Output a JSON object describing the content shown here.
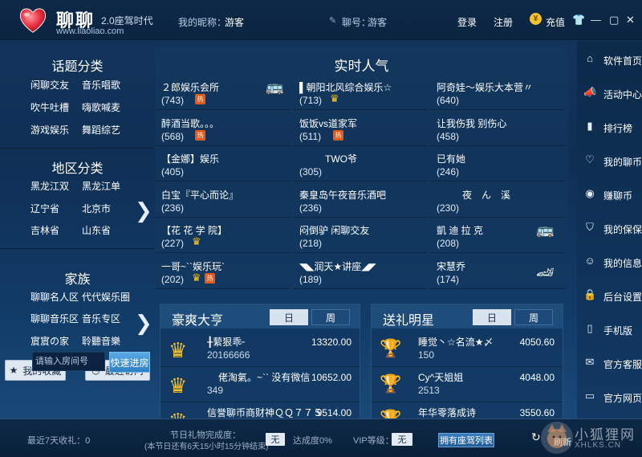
{
  "header": {
    "app_name": "聊聊",
    "version": "2.0座驾时代",
    "url": "www.liaoliao.com",
    "nickname_label": "我的昵称：",
    "nickname_value": "游客",
    "account_label": "聊号：",
    "account_value": "游客",
    "login": "登录",
    "register": "注册",
    "recharge": "充值"
  },
  "left": {
    "topic_title": "话题分类",
    "topics": [
      "闲聊交友",
      "音乐唱歌",
      "吹牛吐槽",
      "嗨歌喊麦",
      "游戏娱乐",
      "舞蹈综艺"
    ],
    "region_title": "地区分类",
    "regions": [
      "黑龙江双",
      "黑龙江单",
      "辽宁省",
      "北京市",
      "吉林省",
      "山东省"
    ],
    "family_title": "家族",
    "families": [
      "聊聊名人区",
      "代代娱乐圈",
      "聊聊音乐区",
      "音乐专区",
      "賔賔の家",
      "聆聽音樂"
    ],
    "favorites": "我的收藏",
    "recent": "最近访问",
    "room_label": "房间号",
    "room_placeholder": "请输入房间号",
    "enter_room": "快速进房"
  },
  "popular": {
    "title": "实时人气",
    "rooms": [
      {
        "name": "２郎娱乐会所",
        "count": "(743)",
        "badge": "hot",
        "car": "bus"
      },
      {
        "name": "▌朝阳北风综合娱乐☆",
        "count": "(713)",
        "badge": "crown",
        "car": ""
      },
      {
        "name": "阿奇娃～娱乐大本营〃",
        "count": "(640)",
        "badge": "",
        "car": ""
      },
      {
        "name": "醉酒当歌。。。",
        "count": "(568)",
        "badge": "hot",
        "car": ""
      },
      {
        "name": "饭饭vs道家军",
        "count": "(511)",
        "badge": "hot",
        "car": ""
      },
      {
        "name": "让我伤我 别伤心",
        "count": "(458)",
        "badge": "",
        "car": ""
      },
      {
        "name": "【金娜】娱乐",
        "count": "(405)",
        "badge": "",
        "car": ""
      },
      {
        "name": "TWO爷",
        "count": "(305)",
        "badge": "",
        "car": ""
      },
      {
        "name": "已有她",
        "count": "(246)",
        "badge": "",
        "car": ""
      },
      {
        "name": "白宝『平心而论』",
        "count": "(236)",
        "badge": "",
        "car": ""
      },
      {
        "name": "秦皇岛午夜音乐酒吧",
        "count": "(236)",
        "badge": "",
        "car": ""
      },
      {
        "name": "夜　ん　溪",
        "count": "(230)",
        "badge": "",
        "car": ""
      },
      {
        "name": "【花 花 学 院】",
        "count": "(227)",
        "badge": "crown",
        "car": ""
      },
      {
        "name": "闷倒驴 闲聊交友",
        "count": "(218)",
        "badge": "",
        "car": ""
      },
      {
        "name": "凱 迪 拉 克",
        "count": "(208)",
        "badge": "",
        "car": "bus"
      },
      {
        "name": "一哥~``娱乐玩`",
        "count": "(202)",
        "badge": "crown-hot",
        "car": ""
      },
      {
        "name": "◥◣润天★讲座◢◤",
        "count": "(189)",
        "badge": "",
        "car": ""
      },
      {
        "name": "宋慧乔",
        "count": "(174)",
        "badge": "",
        "car": "car"
      }
    ]
  },
  "rank_rich": {
    "title": "豪爽大亨",
    "tab_day": "日",
    "tab_week": "周",
    "rows": [
      {
        "name": "╂蕠狠乖╴",
        "id": "20166666",
        "value": "13320.00",
        "rank": 1
      },
      {
        "name": "佬淘氣。~`` 没有微信",
        "id": "349",
        "value": "10652.00",
        "rank": 2
      },
      {
        "name": "信誉聊币商财神ＱＱ７７５",
        "id": "",
        "value": "9514.00",
        "rank": 3
      }
    ]
  },
  "rank_gift": {
    "title": "送礼明星",
    "tab_day": "日",
    "tab_week": "周",
    "rows": [
      {
        "name": "睡觉丶☆名流★〆",
        "id": "150",
        "value": "4050.60",
        "rank": 1
      },
      {
        "name": "Cy^天姐姐",
        "id": "2513",
        "value": "4048.00",
        "rank": 2
      },
      {
        "name": "年华零落成诗",
        "id": "",
        "value": "3550.60",
        "rank": 3
      }
    ]
  },
  "right_nav": [
    {
      "label": "软件首页",
      "icon": "home-icon"
    },
    {
      "label": "活动中心",
      "icon": "megaphone-icon"
    },
    {
      "label": "排行榜",
      "icon": "bar-chart-icon"
    },
    {
      "label": "我的聊币",
      "icon": "heart-icon"
    },
    {
      "label": "赚聊币",
      "icon": "coin-icon"
    },
    {
      "label": "我的保保",
      "icon": "shield-icon"
    },
    {
      "label": "我的信息",
      "icon": "user-icon"
    },
    {
      "label": "后台设置",
      "icon": "lock-icon"
    },
    {
      "label": "手机版",
      "icon": "phone-icon"
    },
    {
      "label": "官方客服",
      "icon": "chat-icon"
    },
    {
      "label": "官方网页",
      "icon": "monitor-icon"
    }
  ],
  "footer": {
    "last7_label": "最近7天收礼：0",
    "festival_label": "节日礼物完成度：",
    "festival_note": "(本节日还有6天15小时15分钟结束)",
    "festival_value": "无",
    "achieve_label": "达成度0%",
    "vip_label": "VIP等级：",
    "vip_value": "无",
    "car_list": "拥有座驾列表",
    "refresh": "刷新"
  },
  "watermark": {
    "text": "小狐狸网",
    "sub": "XHLKS.CN"
  }
}
